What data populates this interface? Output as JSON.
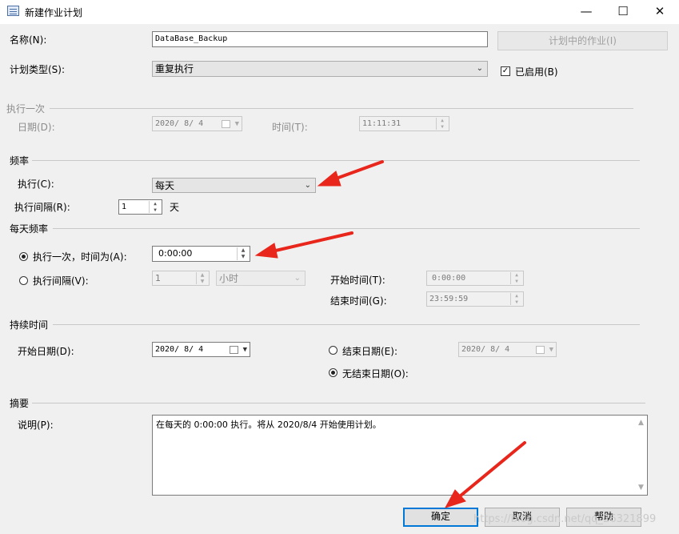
{
  "window": {
    "title": "新建作业计划",
    "minimize": "—",
    "maximize": "☐",
    "close": "✕"
  },
  "name_label": "名称(N):",
  "name_value": "DataBase_Backup",
  "jobs_button": "计划中的作业(I)",
  "schedule_type_label": "计划类型(S):",
  "schedule_type_value": "重复执行",
  "enabled_label": "已启用(B)",
  "enabled_check": "✓",
  "once": {
    "section": "执行一次",
    "date_label": "日期(D):",
    "date_value": "2020/ 8/ 4",
    "time_label": "时间(T):",
    "time_value": "11:11:31"
  },
  "frequency": {
    "section": "频率",
    "occurs_label": "执行(C):",
    "occurs_value": "每天",
    "interval_label": "执行间隔(R):",
    "interval_value": "1",
    "interval_unit": "天"
  },
  "daily": {
    "section": "每天频率",
    "once_label": "执行一次，时间为(A):",
    "once_time": "0:00:00",
    "every_label": "执行间隔(V):",
    "every_value": "1",
    "every_unit": "小时",
    "start_label": "开始时间(T):",
    "start_value": "0:00:00",
    "end_label": "结束时间(G):",
    "end_value": "23:59:59"
  },
  "duration": {
    "section": "持续时间",
    "start_date_label": "开始日期(D):",
    "start_date_value": "2020/ 8/ 4",
    "end_date_label": "结束日期(E):",
    "end_date_value": "2020/ 8/ 4",
    "no_end_label": "无结束日期(O):"
  },
  "summary": {
    "section": "摘要",
    "desc_label": "说明(P):",
    "desc_value": "在每天的 0:00:00 执行。将从 2020/8/4 开始使用计划。"
  },
  "buttons": {
    "ok": "确定",
    "cancel": "取消",
    "help": "帮助"
  },
  "watermark": "https://blog.csdn.net/qq_26321899",
  "colors": {
    "accent": "#0078d7",
    "annotation_arrow": "#e8261c"
  }
}
